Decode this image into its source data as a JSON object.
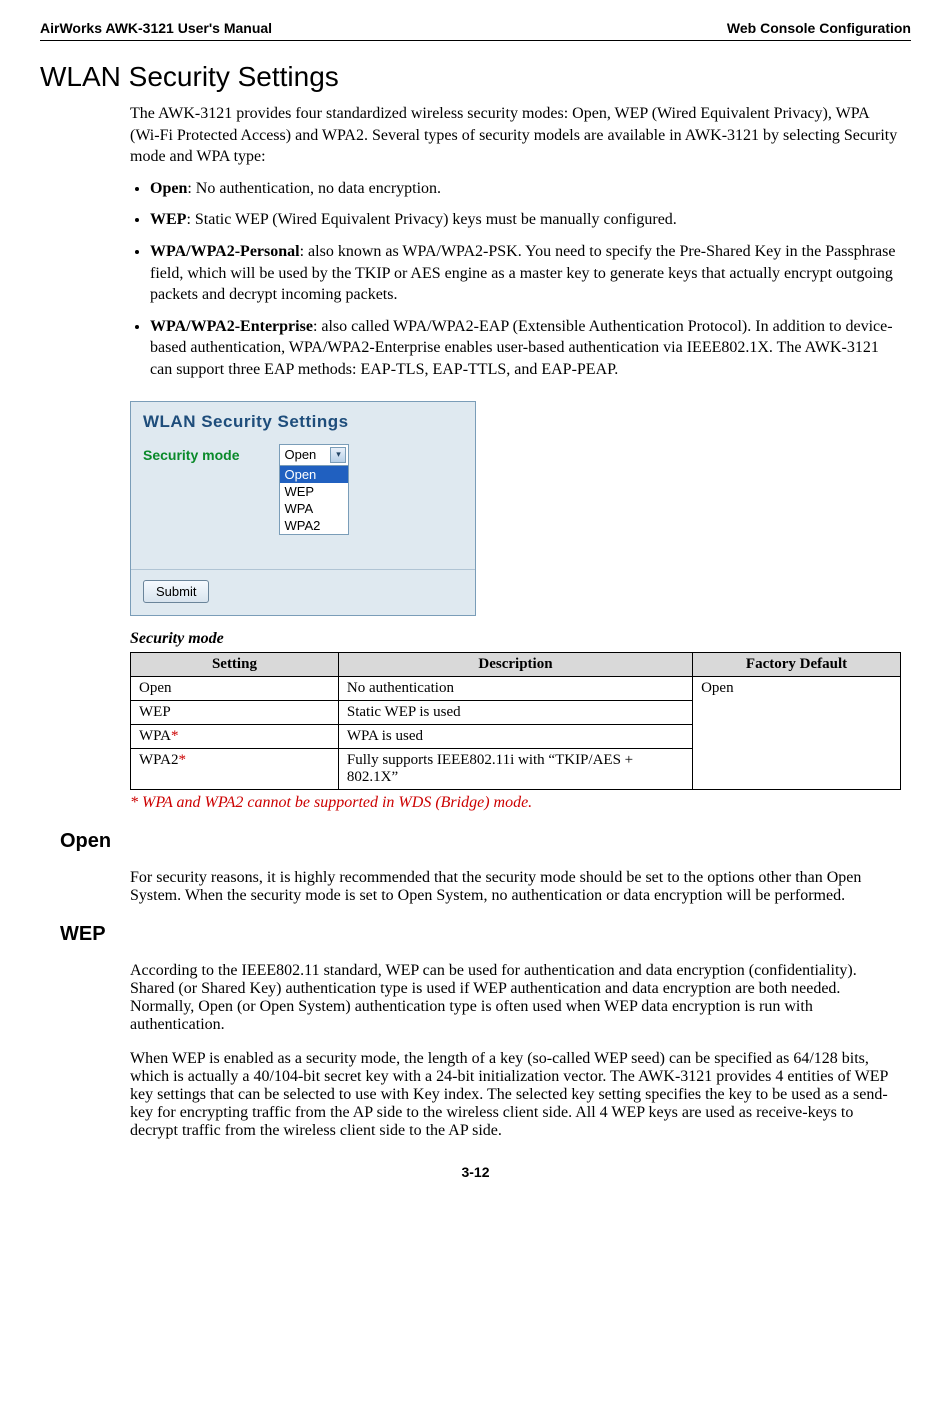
{
  "header": {
    "left": "AirWorks AWK-3121 User's Manual",
    "right": "Web Console Configuration"
  },
  "title": "WLAN Security Settings",
  "intro": "The AWK-3121 provides four standardized wireless security modes: Open, WEP (Wired Equivalent Privacy), WPA (Wi-Fi Protected Access) and WPA2. Several types of security models are available in AWK-3121 by selecting Security mode and WPA type:",
  "bullets": [
    {
      "b": "Open",
      "t": ": No authentication, no data encryption."
    },
    {
      "b": "WEP",
      "t": ": Static WEP (Wired Equivalent Privacy) keys must be manually configured."
    },
    {
      "b": "WPA/WPA2-Personal",
      "t": ": also known as WPA/WPA2-PSK. You need to specify the Pre-Shared Key in the Passphrase field, which will be used by the TKIP or AES engine as a master key to generate keys that actually encrypt outgoing packets and decrypt incoming packets."
    },
    {
      "b": "WPA/WPA2-Enterprise",
      "t": ": also called WPA/WPA2-EAP (Extensible Authentication Protocol). In addition to device-based authentication, WPA/WPA2-Enterprise enables user-based authentication via IEEE802.1X. The AWK-3121 can support three EAP methods: EAP-TLS, EAP-TTLS, and EAP-PEAP."
    }
  ],
  "panel": {
    "title": "WLAN Security Settings",
    "label": "Security mode",
    "selected": "Open",
    "options": [
      "Open",
      "WEP",
      "WPA",
      "WPA2"
    ],
    "submit": "Submit"
  },
  "tableCaption": "Security mode",
  "table": {
    "headers": [
      "Setting",
      "Description",
      "Factory Default"
    ],
    "rows": [
      {
        "s": "Open",
        "star": "",
        "d": "No authentication"
      },
      {
        "s": "WEP",
        "star": "",
        "d": "Static WEP is used"
      },
      {
        "s": "WPA",
        "star": "*",
        "d": "WPA is used"
      },
      {
        "s": "WPA2",
        "star": "*",
        "d": "Fully supports IEEE802.11i with “TKIP/AES + 802.1X”"
      }
    ],
    "default": "Open"
  },
  "note": "* WPA and WPA2 cannot be supported in WDS (Bridge) mode.",
  "openHeading": "Open",
  "openText": "For security reasons, it is highly recommended that the security mode should be set to the options other than Open System. When the security mode is set to Open System, no authentication or data encryption will be performed.",
  "wepHeading": "WEP",
  "wepP1": "According to the IEEE802.11 standard, WEP can be used for authentication and data encryption (confidentiality). Shared (or Shared Key) authentication type is used if WEP authentication and data encryption are both needed. Normally, Open (or Open System) authentication type is often used when WEP data encryption is run with authentication.",
  "wepP2": "When WEP is enabled as a security mode, the length of a key (so-called WEP seed) can be specified as 64/128 bits, which is actually a 40/104-bit secret key with a 24-bit initialization vector. The AWK-3121 provides 4 entities of WEP key settings that can be selected to use with Key index. The selected key setting specifies the key to be used as a send-key for encrypting traffic from the AP side to the wireless client side. All 4 WEP keys are used as receive-keys to decrypt traffic from the wireless client side to the AP side.",
  "pageNumber": "3-12"
}
